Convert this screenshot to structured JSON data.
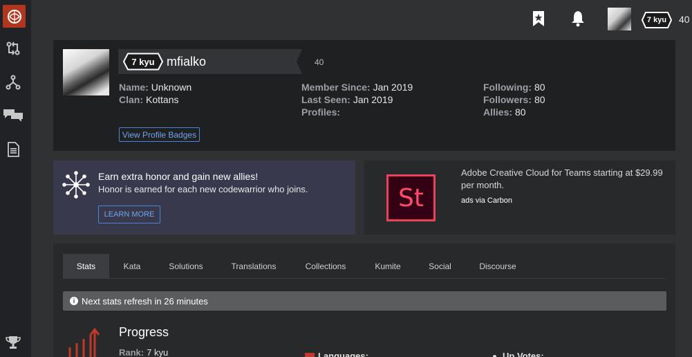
{
  "topbar": {
    "rank": "7 kyu",
    "honor": "40"
  },
  "profile": {
    "rank": "7 kyu",
    "username": "mfialko",
    "honor": "40",
    "col1": [
      {
        "key": "Name:",
        "value": "Unknown"
      },
      {
        "key": "Clan:",
        "value": "Kottans"
      }
    ],
    "col2": [
      {
        "key": "Member Since:",
        "value": "Jan 2019"
      },
      {
        "key": "Last Seen:",
        "value": "Jan 2019"
      },
      {
        "key": "Profiles:",
        "value": ""
      }
    ],
    "col3": [
      {
        "key": "Following:",
        "value": "80"
      },
      {
        "key": "Followers:",
        "value": "80"
      },
      {
        "key": "Allies:",
        "value": "80"
      }
    ],
    "badges_button": "View Profile Badges"
  },
  "promo": {
    "title": "Earn extra honor and gain new allies!",
    "subtitle": "Honor is earned for each new codewarrior who joins.",
    "button": "LEARN MORE"
  },
  "ad": {
    "logo_text": "St",
    "text": "Adobe Creative Cloud for Teams starting at $29.99 per month.",
    "via": "ads via Carbon"
  },
  "stats": {
    "tabs": [
      "Stats",
      "Kata",
      "Solutions",
      "Translations",
      "Collections",
      "Kumite",
      "Social",
      "Discourse"
    ],
    "active_tab": "Stats",
    "notice": "Next stats refresh in 26 minutes",
    "progress_title": "Progress",
    "rank_key": "Rank:",
    "rank_value": "7 kyu",
    "languages_label": "Languages:",
    "upvotes_label": "Up Votes:"
  }
}
